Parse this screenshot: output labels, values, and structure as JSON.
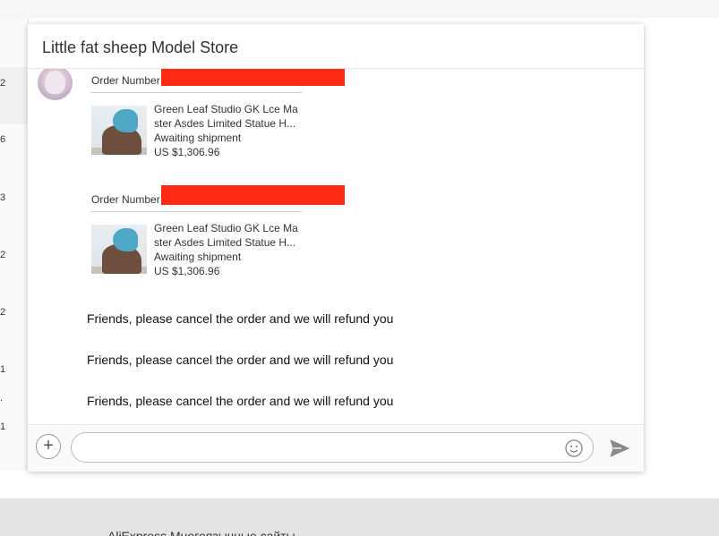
{
  "page": {
    "footer_link": "AliExpress Многоязычные сайты"
  },
  "sidebar": {
    "items": [
      "2",
      "6",
      "3",
      "2",
      "2",
      "1",
      ".",
      "1"
    ]
  },
  "chat": {
    "title": "Little fat sheep Model Store",
    "orders": [
      {
        "order_label": "Order Number",
        "product_title_line1": "Green Leaf Studio GK Lce Ma",
        "product_title_line2": "ster Asdes Limited Statue H...",
        "status": "Awaiting shipment",
        "price": "US $1,306.96"
      },
      {
        "order_label": "Order Number",
        "product_title_line1": "Green Leaf Studio GK Lce Ma",
        "product_title_line2": "ster Asdes Limited Statue H...",
        "status": "Awaiting shipment",
        "price": "US $1,306.96"
      }
    ],
    "messages": [
      "Friends, please cancel the order and we will refund you",
      "Friends, please cancel the order and we will refund you",
      "Friends, please cancel the order and we will refund you"
    ],
    "input": {
      "value": "",
      "placeholder": ""
    }
  },
  "icons": {
    "plus": "plus-icon",
    "emoji": "emoji-icon",
    "send": "send-icon"
  },
  "colors": {
    "redaction": "#ff2a12",
    "send_icon": "#8a8a8a"
  }
}
